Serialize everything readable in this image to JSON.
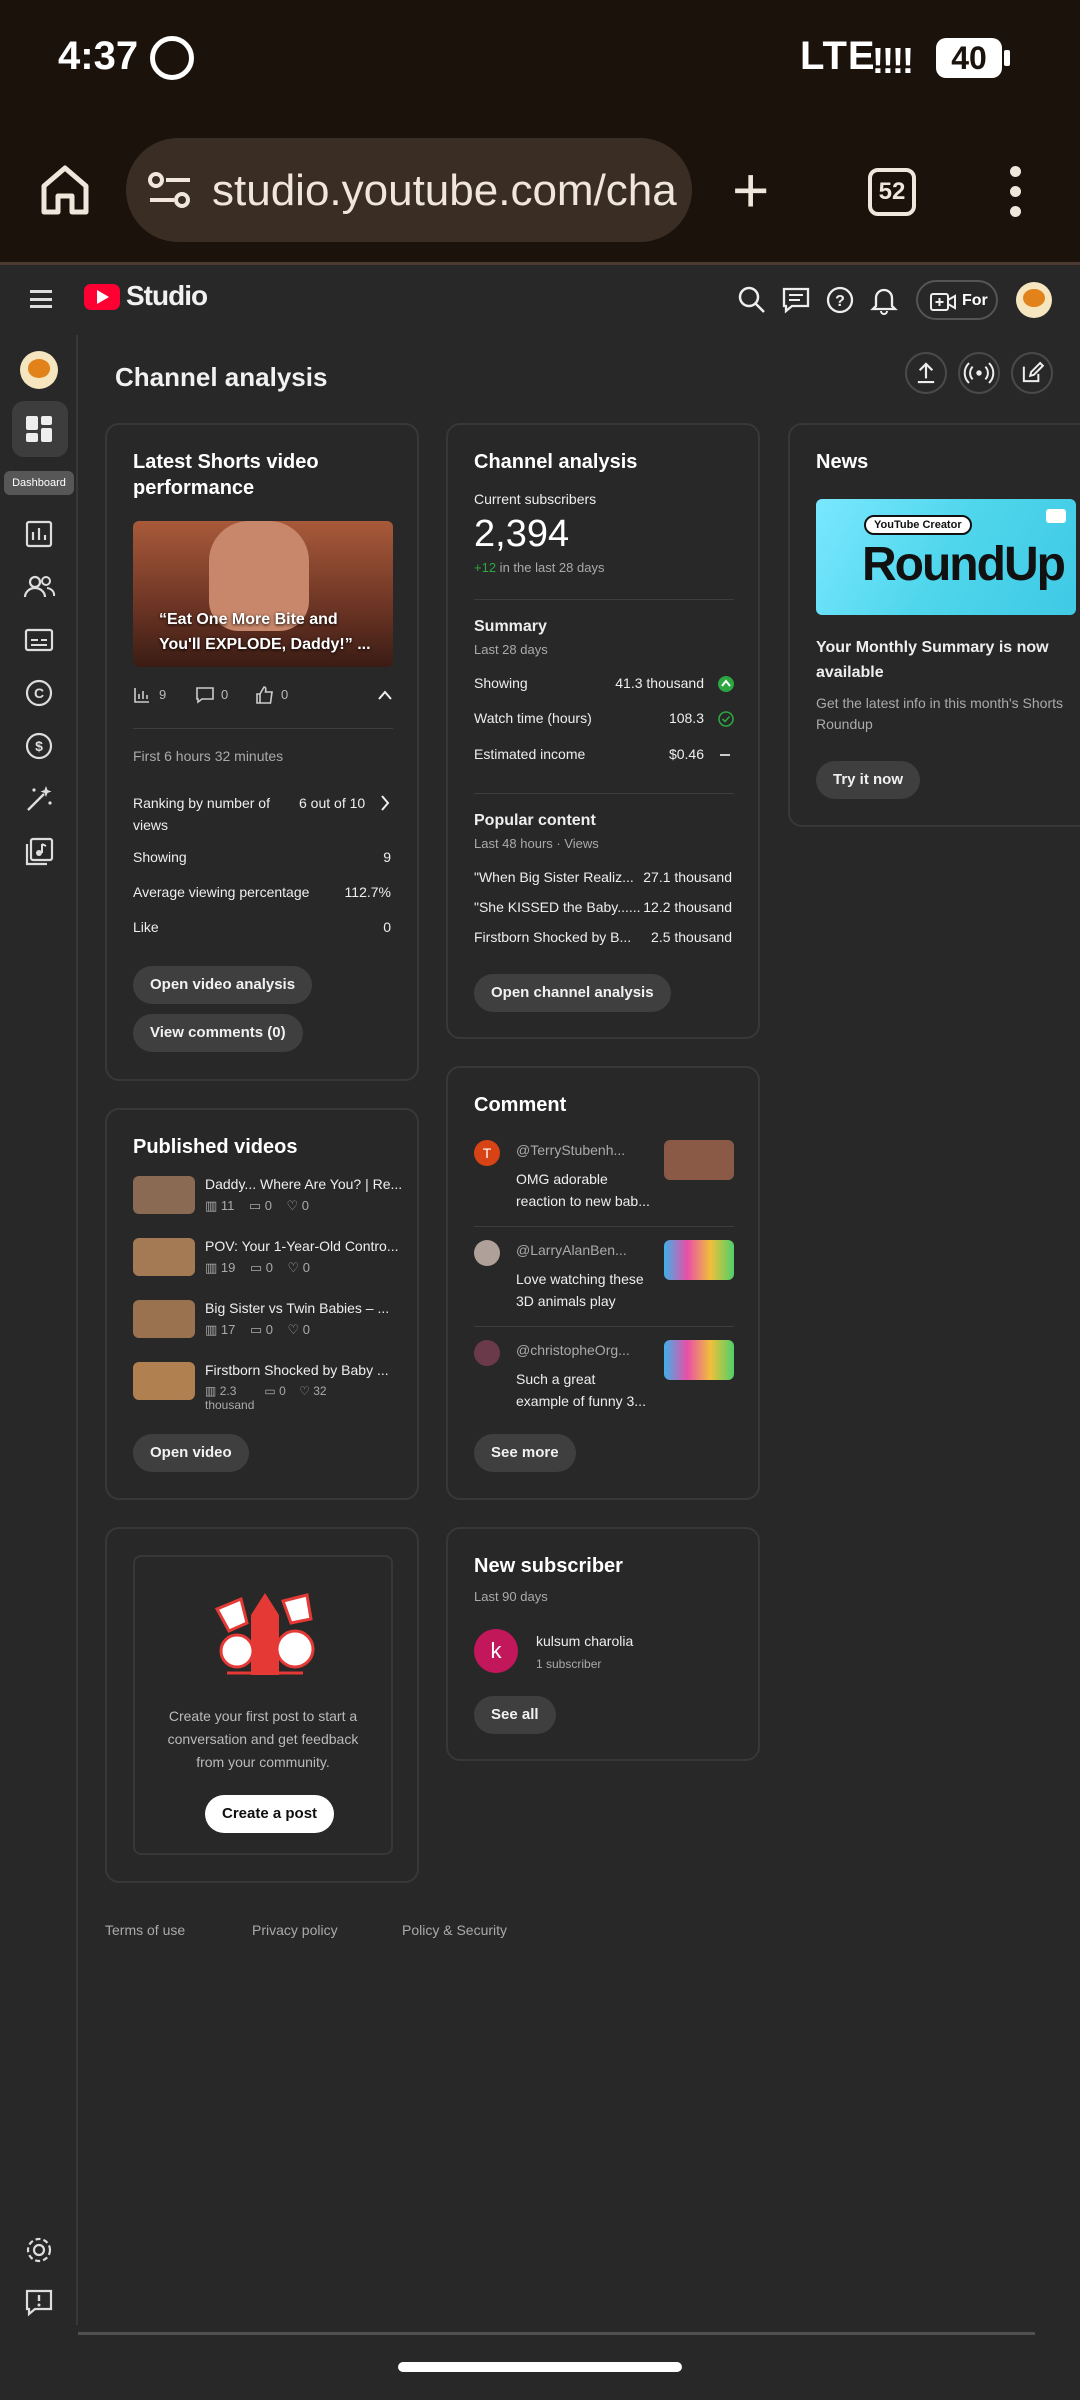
{
  "status_bar": {
    "time": "4:37",
    "network": "LTE",
    "signal": "!!!!",
    "battery": "40"
  },
  "browser": {
    "url": "studio.youtube.com/cha",
    "tab_count": "52"
  },
  "header": {
    "brand": "Studio",
    "create_label": "For"
  },
  "sidebar": {
    "tooltip": "Dashboard"
  },
  "page": {
    "title": "Channel analysis"
  },
  "shorts_card": {
    "title_line1": "Latest Shorts video",
    "title_line2": "performance",
    "thumb_caption_line1": "“Eat One More Bite and",
    "thumb_caption_line2": "You'll EXPLODE, Daddy!” ...",
    "views": "9",
    "comments": "0",
    "likes": "0",
    "period": "First 6 hours 32 minutes",
    "ranking_label_line1": "Ranking by number of",
    "ranking_label_line2": "views",
    "ranking_value": "6 out of 10",
    "stats": [
      {
        "label": "Showing",
        "value": "9"
      },
      {
        "label": "Average viewing percentage",
        "value": "112.7%"
      },
      {
        "label": "Like",
        "value": "0"
      }
    ],
    "open_button": "Open video analysis",
    "comments_button": "View comments (0)"
  },
  "analytics_card": {
    "title": "Channel analysis",
    "subs_label": "Current subscribers",
    "subs_value": "2,394",
    "subs_change": "+12",
    "subs_change_suffix": " in the last 28 days",
    "summary_title": "Summary",
    "summary_period": "Last 28 days",
    "summary": [
      {
        "label": "Showing",
        "value": "41.3 thousand"
      },
      {
        "label": "Watch time (hours)",
        "value": "108.3"
      },
      {
        "label": "Estimated income",
        "value": "$0.46"
      }
    ],
    "popular_title": "Popular content",
    "popular_period": "Last 48 hours · Views",
    "popular": [
      {
        "title": "\"When Big Sister Realiz...",
        "value": "27.1 thousand"
      },
      {
        "title": "\"She KISSED the Baby......",
        "value": "12.2 thousand"
      },
      {
        "title": "Firstborn Shocked by B...",
        "value": "2.5 thousand"
      }
    ],
    "button": "Open channel analysis"
  },
  "news_card": {
    "title": "News",
    "banner_tag": "YouTube Creator",
    "banner_title": "RoundUp",
    "headline_line1": "Your Monthly Summary is now",
    "headline_line2": "available",
    "desc_line1": "Get the latest info in this month's Shorts",
    "desc_line2": "Roundup",
    "button": "Try it now"
  },
  "published_card": {
    "title": "Published videos",
    "videos": [
      {
        "title": "Daddy... Where Are You? | Re...",
        "views": "11",
        "comments": "0",
        "likes": "0"
      },
      {
        "title": "POV: Your 1-Year-Old Contro...",
        "views": "19",
        "comments": "0",
        "likes": "0"
      },
      {
        "title": "Big Sister vs Twin Babies – ...",
        "views": "17",
        "comments": "0",
        "likes": "0"
      },
      {
        "title": "Firstborn Shocked by Baby ...",
        "views_line1": "2.3",
        "views_line2": "thousand",
        "comments": "0",
        "likes": "32"
      }
    ],
    "button": "Open video"
  },
  "comment_card": {
    "title": "Comment",
    "comments": [
      {
        "author": "@TerryStubenh...",
        "avatar_letter": "T",
        "text_line1": "OMG adorable",
        "text_line2": "reaction to new bab..."
      },
      {
        "author": "@LarryAlanBen...",
        "text_line1": "Love watching these",
        "text_line2": "3D animals play"
      },
      {
        "author": "@christopheOrg...",
        "text_line1": "Such a great",
        "text_line2": "example of funny 3..."
      }
    ],
    "button": "See more"
  },
  "post_card": {
    "text_line1": "Create your first post to start a",
    "text_line2": "conversation and get feedback",
    "text_line3": "from your community.",
    "button": "Create a post"
  },
  "subscriber_card": {
    "title": "New subscriber",
    "period": "Last 90 days",
    "name": "kulsum charolia",
    "avatar_letter": "k",
    "meta": "1 subscriber",
    "button": "See all"
  },
  "footer": {
    "terms": "Terms of use",
    "privacy": "Privacy policy",
    "security": "Policy & Security"
  },
  "colors": {
    "accent_red": "#ff0033",
    "positive_green": "#2ba640",
    "bg": "#282828"
  }
}
